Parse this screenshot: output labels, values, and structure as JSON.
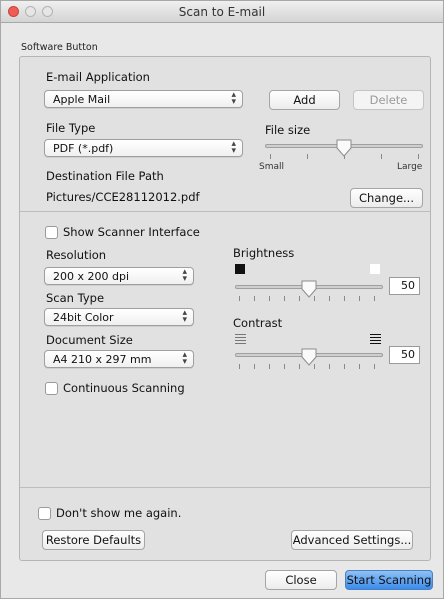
{
  "window": {
    "title": "Scan to E-mail"
  },
  "group_label": "Software Button",
  "email_app": {
    "label": "E-mail Application",
    "selected": "Apple Mail",
    "add_label": "Add",
    "delete_label": "Delete"
  },
  "file_type": {
    "label": "File Type",
    "selected": "PDF (*.pdf)"
  },
  "file_size": {
    "label": "File size",
    "min_label": "Small",
    "max_label": "Large",
    "level_fraction": 0.5
  },
  "destination": {
    "label": "Destination File Path",
    "path": "Pictures/CCE28112012.pdf",
    "change_label": "Change..."
  },
  "scanner": {
    "show_interface_label": "Show Scanner Interface",
    "show_interface_checked": false
  },
  "resolution": {
    "label": "Resolution",
    "selected": "200 x 200 dpi"
  },
  "scan_type": {
    "label": "Scan Type",
    "selected": "24bit Color"
  },
  "document_size": {
    "label": "Document Size",
    "selected": "A4 210 x 297 mm"
  },
  "continuous": {
    "label": "Continuous Scanning",
    "checked": false
  },
  "brightness": {
    "label": "Brightness",
    "value": "50",
    "level_fraction": 0.5
  },
  "contrast": {
    "label": "Contrast",
    "value": "50",
    "level_fraction": 0.5
  },
  "dont_show": {
    "label": "Don't show me again.",
    "checked": false
  },
  "footer": {
    "restore_label": "Restore Defaults",
    "advanced_label": "Advanced Settings...",
    "close_label": "Close",
    "start_label": "Start Scanning"
  }
}
